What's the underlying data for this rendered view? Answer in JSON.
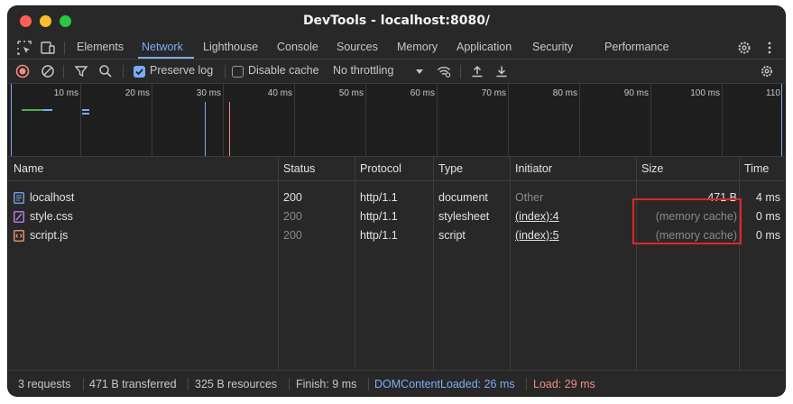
{
  "window": {
    "title": "DevTools - localhost:8080/"
  },
  "tabs": [
    "Elements",
    "Network",
    "Lighthouse",
    "Console",
    "Sources",
    "Memory",
    "Application",
    "Security",
    "Performance"
  ],
  "active_tab": "Network",
  "toolbar": {
    "preserve_log": {
      "label": "Preserve log",
      "checked": true
    },
    "disable_cache": {
      "label": "Disable cache",
      "checked": false
    },
    "throttling": "No throttling"
  },
  "overview": {
    "ticks": [
      "10 ms",
      "20 ms",
      "30 ms",
      "40 ms",
      "50 ms",
      "60 ms",
      "70 ms",
      "80 ms",
      "90 ms",
      "100 ms",
      "110"
    ]
  },
  "table": {
    "columns": [
      "Name",
      "Status",
      "Protocol",
      "Type",
      "Initiator",
      "Size",
      "Time"
    ],
    "rows": [
      {
        "name": "localhost",
        "status": "200",
        "protocol": "http/1.1",
        "type": "document",
        "initiator": "Other",
        "size": "471 B",
        "time": "4 ms"
      },
      {
        "name": "style.css",
        "status": "200",
        "protocol": "http/1.1",
        "type": "stylesheet",
        "initiator": "(index):4",
        "size": "(memory cache)",
        "time": "0 ms"
      },
      {
        "name": "script.js",
        "status": "200",
        "protocol": "http/1.1",
        "type": "script",
        "initiator": "(index):5",
        "size": "(memory cache)",
        "time": "0 ms"
      }
    ]
  },
  "status": {
    "requests": "3 requests",
    "transferred": "471 B transferred",
    "resources": "325 B resources",
    "finish": "Finish: 9 ms",
    "dom_content_loaded": "DOMContentLoaded: 26 ms",
    "load": "Load: 29 ms"
  },
  "colors": {
    "accent": "#7cacf8",
    "highlight_box": "#e0262a",
    "load": "#f28b82"
  }
}
